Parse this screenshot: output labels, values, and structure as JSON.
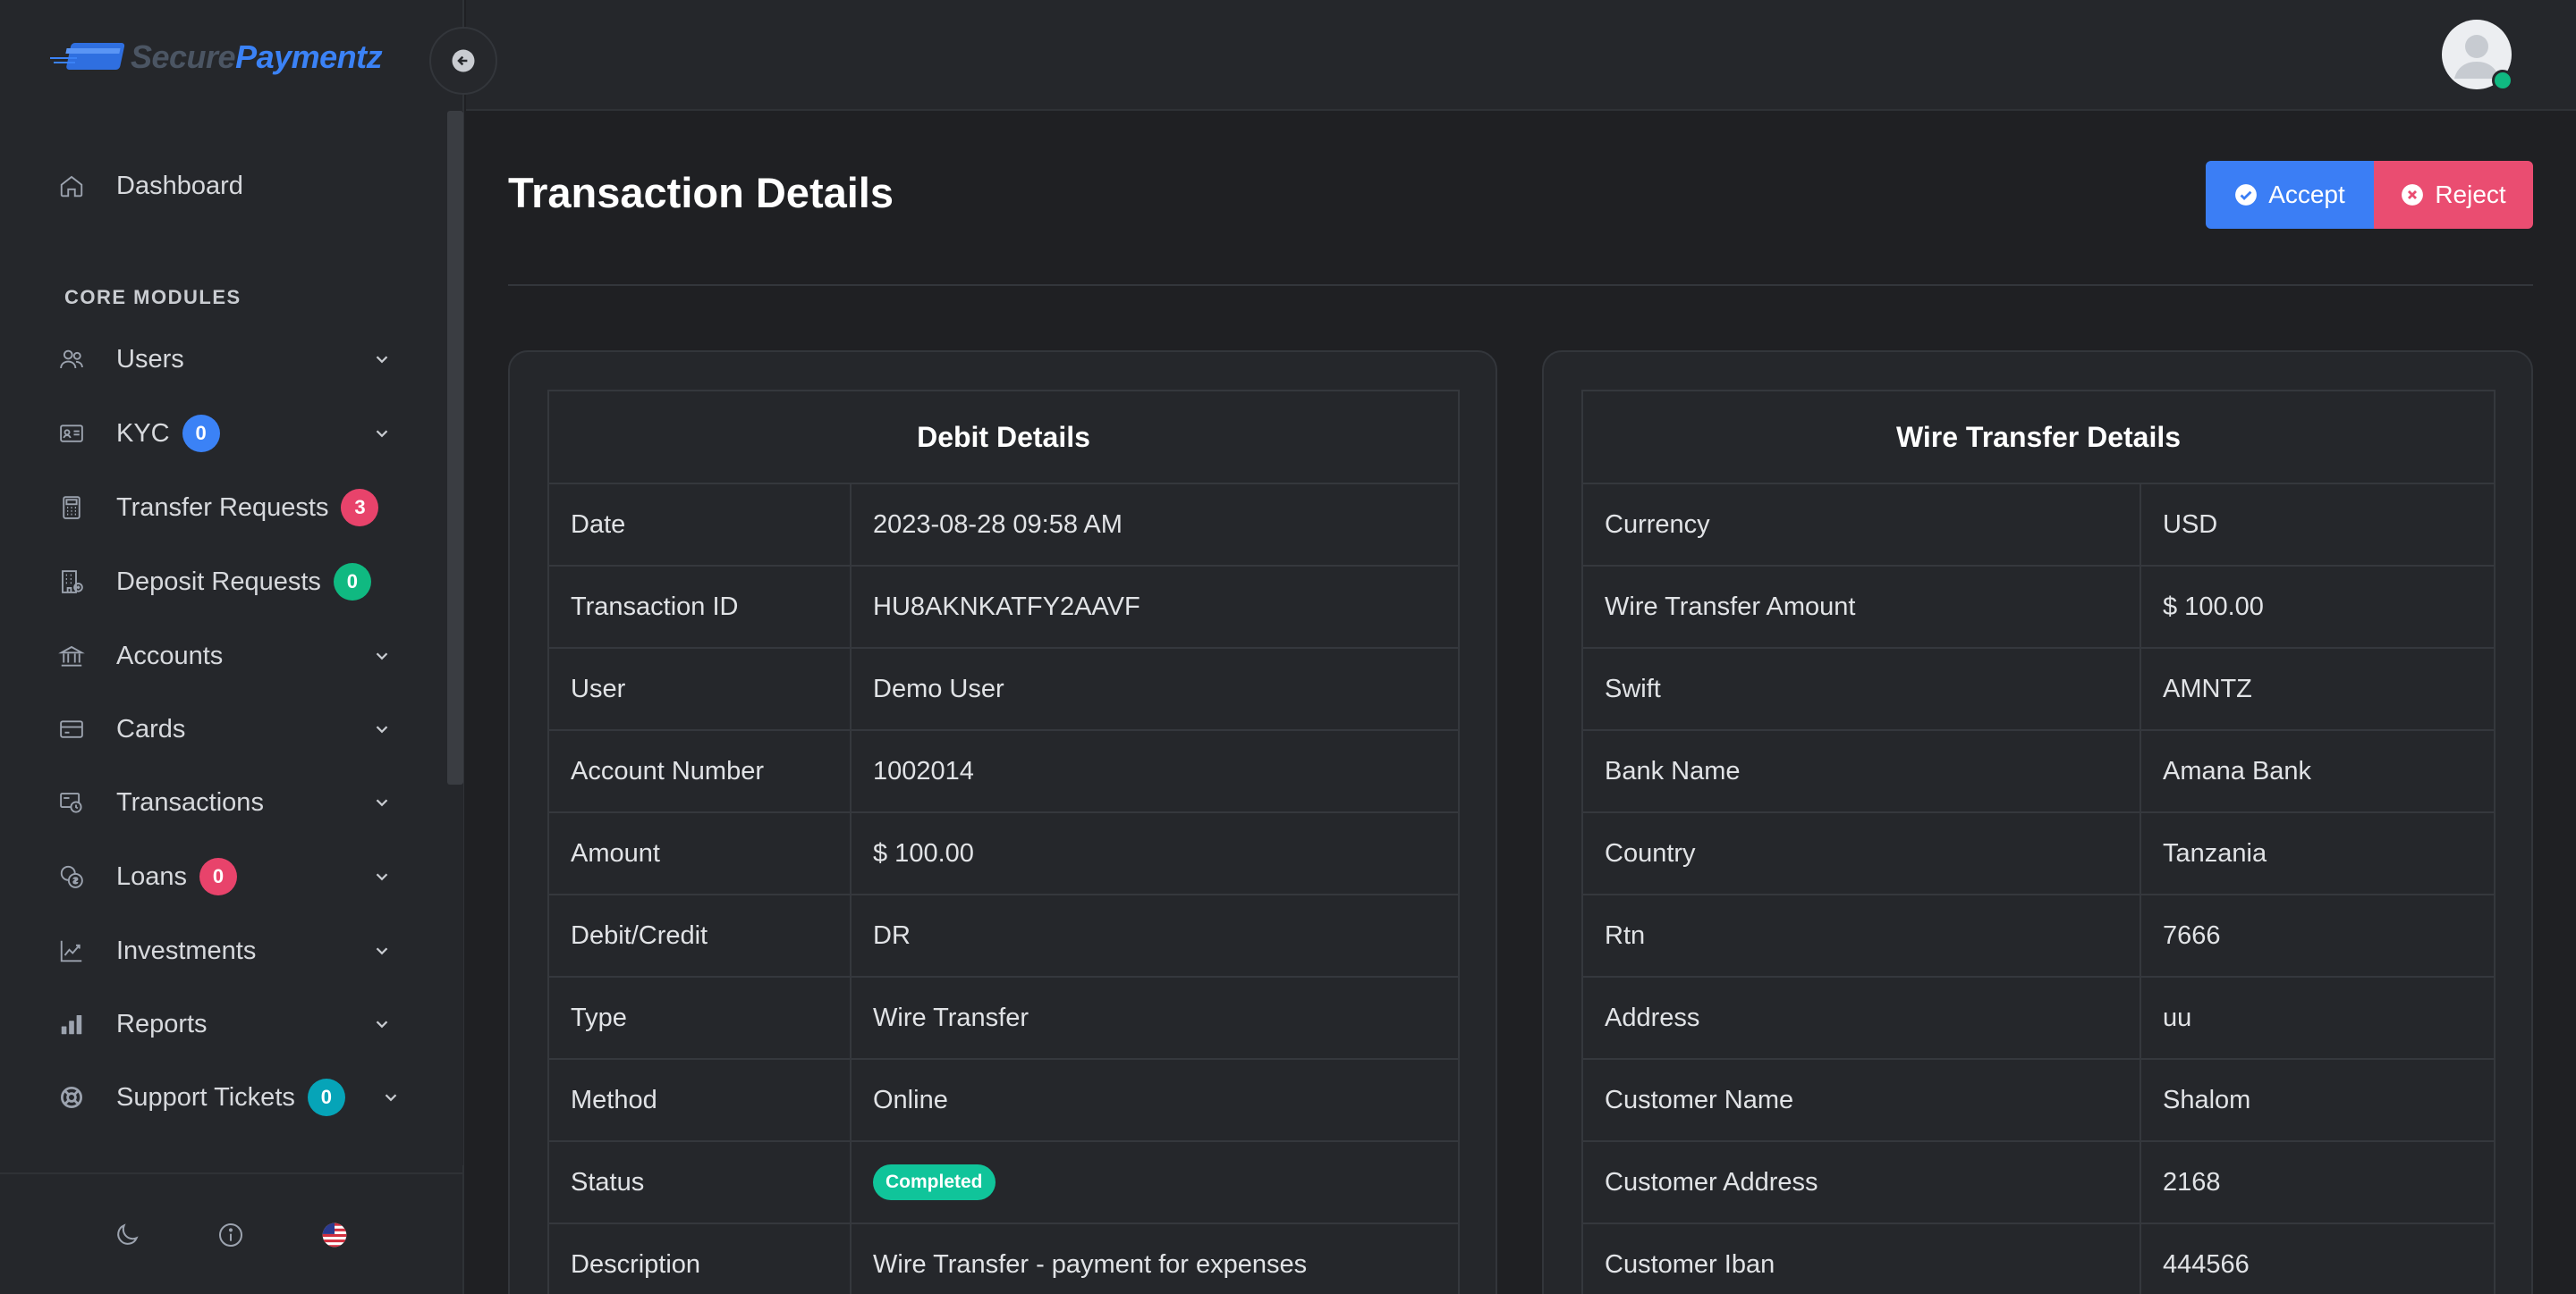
{
  "brand": {
    "name_part1": "Secure",
    "name_part2": "Paymentz"
  },
  "sidebar": {
    "dashboard": "Dashboard",
    "section_label": "CORE MODULES",
    "items": [
      {
        "label": "Users",
        "icon": "users-icon",
        "badge": null,
        "has_chevron": true
      },
      {
        "label": "KYC",
        "icon": "id-card-icon",
        "badge": "0",
        "badge_color": "#3b82f6",
        "has_chevron": true
      },
      {
        "label": "Transfer Requests",
        "icon": "calculator-icon",
        "badge": "3",
        "badge_color": "#e8436b",
        "has_chevron": false
      },
      {
        "label": "Deposit Requests",
        "icon": "building-icon",
        "badge": "0",
        "badge_color": "#10b981",
        "has_chevron": false
      },
      {
        "label": "Accounts",
        "icon": "bank-icon",
        "badge": null,
        "has_chevron": true
      },
      {
        "label": "Cards",
        "icon": "credit-card-icon",
        "badge": null,
        "has_chevron": true
      },
      {
        "label": "Transactions",
        "icon": "transactions-icon",
        "badge": null,
        "has_chevron": true
      },
      {
        "label": "Loans",
        "icon": "coins-icon",
        "badge": "0",
        "badge_color": "#e8436b",
        "has_chevron": true
      },
      {
        "label": "Investments",
        "icon": "chart-line-icon",
        "badge": null,
        "has_chevron": true
      },
      {
        "label": "Reports",
        "icon": "bar-chart-icon",
        "badge": null,
        "has_chevron": true
      },
      {
        "label": "Support Tickets",
        "icon": "lifebuoy-icon",
        "badge": "0",
        "badge_color": "#06a4b8",
        "has_chevron": true
      }
    ],
    "footer_icons": [
      "moon-icon",
      "info-icon",
      "us-flag-icon"
    ]
  },
  "main": {
    "title": "Transaction Details",
    "accept_label": "Accept",
    "reject_label": "Reject",
    "debit": {
      "heading": "Debit Details",
      "rows": [
        {
          "key": "Date",
          "value": "2023-08-28 09:58 AM"
        },
        {
          "key": "Transaction ID",
          "value": "HU8AKNKATFY2AAVF"
        },
        {
          "key": "User",
          "value": "Demo User"
        },
        {
          "key": "Account Number",
          "value": "1002014"
        },
        {
          "key": "Amount",
          "value": "$ 100.00"
        },
        {
          "key": "Debit/Credit",
          "value": "DR"
        },
        {
          "key": "Type",
          "value": "Wire Transfer"
        },
        {
          "key": "Method",
          "value": "Online"
        },
        {
          "key": "Status",
          "value": "Completed"
        },
        {
          "key": "Description",
          "value": "Wire Transfer - payment for expenses"
        }
      ]
    },
    "wire": {
      "heading": "Wire Transfer Details",
      "rows": [
        {
          "key": "Currency",
          "value": "USD"
        },
        {
          "key": "Wire Transfer Amount",
          "value": "$ 100.00"
        },
        {
          "key": "Swift",
          "value": "AMNTZ"
        },
        {
          "key": "Bank Name",
          "value": "Amana Bank"
        },
        {
          "key": "Country",
          "value": "Tanzania"
        },
        {
          "key": "Rtn",
          "value": "7666"
        },
        {
          "key": "Address",
          "value": "uu"
        },
        {
          "key": "Customer Name",
          "value": "Shalom"
        },
        {
          "key": "Customer Address",
          "value": "2168"
        },
        {
          "key": "Customer Iban",
          "value": "444566"
        }
      ]
    }
  },
  "colors": {
    "accent": "#3b7ef5",
    "danger": "#ea4d71",
    "success": "#10c49a"
  }
}
